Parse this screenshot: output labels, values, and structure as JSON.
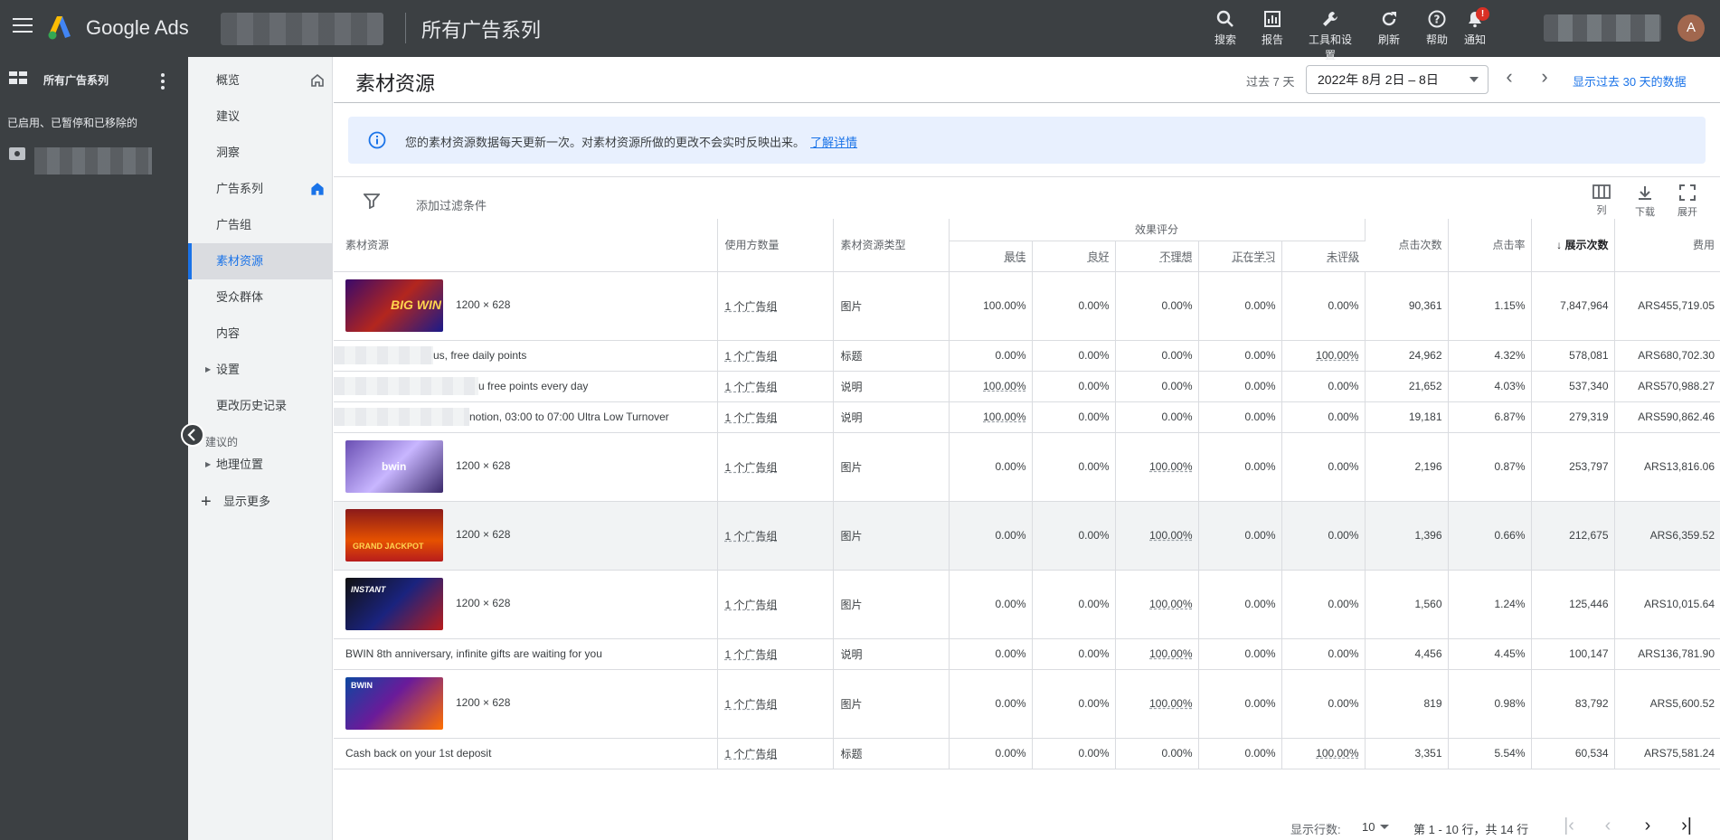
{
  "topbar": {
    "brand": "Google Ads",
    "page_title": "所有广告系列",
    "tools": [
      {
        "label": "搜索",
        "icon": "search-icon"
      },
      {
        "label": "报告",
        "icon": "report-icon"
      },
      {
        "label": "工具和设置",
        "icon": "wrench-icon"
      },
      {
        "label": "刷新",
        "icon": "refresh-icon"
      },
      {
        "label": "帮助",
        "icon": "help-icon"
      },
      {
        "label": "通知",
        "icon": "bell-icon"
      }
    ],
    "notification_badge": "!",
    "avatar_letter": "A"
  },
  "leftnav": {
    "title": "所有广告系列",
    "status_filter": "已启用、已暂停和已移除的"
  },
  "subnav": {
    "items": [
      "概览",
      "建议",
      "洞察",
      "广告系列",
      "广告组",
      "素材资源",
      "受众群体",
      "内容",
      "设置",
      "更改历史记录"
    ],
    "suggested_label": "建议的",
    "location": "地理位置",
    "show_more": "显示更多"
  },
  "header": {
    "title": "素材资源",
    "range_label": "过去 7 天",
    "date_range": "2022年 8月 2日 – 8日",
    "show_30": "显示过去 30 天的数据"
  },
  "info": {
    "text": "您的素材资源数据每天更新一次。对素材资源所做的更改不会实时反映出来。",
    "link": "了解详情"
  },
  "toolbar": {
    "add_filter": "添加过滤条件",
    "columns": "列",
    "download": "下载",
    "expand": "展开"
  },
  "table": {
    "headers": {
      "asset": "素材资源",
      "used_by": "使用方数量",
      "type": "素材资源类型",
      "perf": "效果评分",
      "best": "最佳",
      "good": "良好",
      "low": "不理想",
      "learning": "正在学习",
      "unrated": "未评级",
      "clicks": "点击次数",
      "ctr": "点击率",
      "impr": "展示次数",
      "cost": "费用"
    },
    "rows": [
      {
        "asset": "1200 × 628",
        "used": "1 个广告组",
        "type": "图片",
        "best": "100.00%",
        "good": "0.00%",
        "low": "0.00%",
        "learning": "0.00%",
        "unrated": "0.00%",
        "clicks": "90,361",
        "ctr": "1.15%",
        "impr": "7,847,964",
        "cost": "ARS455,719.05"
      },
      {
        "asset": "us, free daily points",
        "used": "1 个广告组",
        "type": "标题",
        "best": "0.00%",
        "good": "0.00%",
        "low": "0.00%",
        "learning": "0.00%",
        "unrated": "100.00%",
        "clicks": "24,962",
        "ctr": "4.32%",
        "impr": "578,081",
        "cost": "ARS680,702.30"
      },
      {
        "asset": "u free points every day",
        "used": "1 个广告组",
        "type": "说明",
        "best": "100.00%",
        "good": "0.00%",
        "low": "0.00%",
        "learning": "0.00%",
        "unrated": "0.00%",
        "clicks": "21,652",
        "ctr": "4.03%",
        "impr": "537,340",
        "cost": "ARS570,988.27"
      },
      {
        "asset": "notion, 03:00 to 07:00 Ultra Low Turnover",
        "used": "1 个广告组",
        "type": "说明",
        "best": "100.00%",
        "good": "0.00%",
        "low": "0.00%",
        "learning": "0.00%",
        "unrated": "0.00%",
        "clicks": "19,181",
        "ctr": "6.87%",
        "impr": "279,319",
        "cost": "ARS590,862.46"
      },
      {
        "asset": "1200 × 628",
        "used": "1 个广告组",
        "type": "图片",
        "best": "0.00%",
        "good": "0.00%",
        "low": "100.00%",
        "learning": "0.00%",
        "unrated": "0.00%",
        "clicks": "2,196",
        "ctr": "0.87%",
        "impr": "253,797",
        "cost": "ARS13,816.06"
      },
      {
        "asset": "1200 × 628",
        "used": "1 个广告组",
        "type": "图片",
        "best": "0.00%",
        "good": "0.00%",
        "low": "100.00%",
        "learning": "0.00%",
        "unrated": "0.00%",
        "clicks": "1,396",
        "ctr": "0.66%",
        "impr": "212,675",
        "cost": "ARS6,359.52"
      },
      {
        "asset": "1200 × 628",
        "used": "1 个广告组",
        "type": "图片",
        "best": "0.00%",
        "good": "0.00%",
        "low": "100.00%",
        "learning": "0.00%",
        "unrated": "0.00%",
        "clicks": "1,560",
        "ctr": "1.24%",
        "impr": "125,446",
        "cost": "ARS10,015.64"
      },
      {
        "asset": "BWIN 8th anniversary, infinite gifts are waiting for you",
        "used": "1 个广告组",
        "type": "说明",
        "best": "0.00%",
        "good": "0.00%",
        "low": "100.00%",
        "learning": "0.00%",
        "unrated": "0.00%",
        "clicks": "4,456",
        "ctr": "4.45%",
        "impr": "100,147",
        "cost": "ARS136,781.90"
      },
      {
        "asset": "1200 × 628",
        "used": "1 个广告组",
        "type": "图片",
        "best": "0.00%",
        "good": "0.00%",
        "low": "100.00%",
        "learning": "0.00%",
        "unrated": "0.00%",
        "clicks": "819",
        "ctr": "0.98%",
        "impr": "83,792",
        "cost": "ARS5,600.52"
      },
      {
        "asset": "Cash back on your 1st deposit",
        "used": "1 个广告组",
        "type": "标题",
        "best": "0.00%",
        "good": "0.00%",
        "low": "0.00%",
        "learning": "0.00%",
        "unrated": "100.00%",
        "clicks": "3,351",
        "ctr": "5.54%",
        "impr": "60,534",
        "cost": "ARS75,581.24"
      }
    ]
  },
  "footer": {
    "rows_label": "显示行数:",
    "rows_value": "10",
    "page_info": "第 1 - 10 行，共 14 行"
  },
  "thumb_text": {
    "t1": "BIG WIN",
    "t2": "bwin",
    "t3": "GRAND JACKPOT",
    "t4": "INSTANT",
    "t5": "BWIN"
  }
}
